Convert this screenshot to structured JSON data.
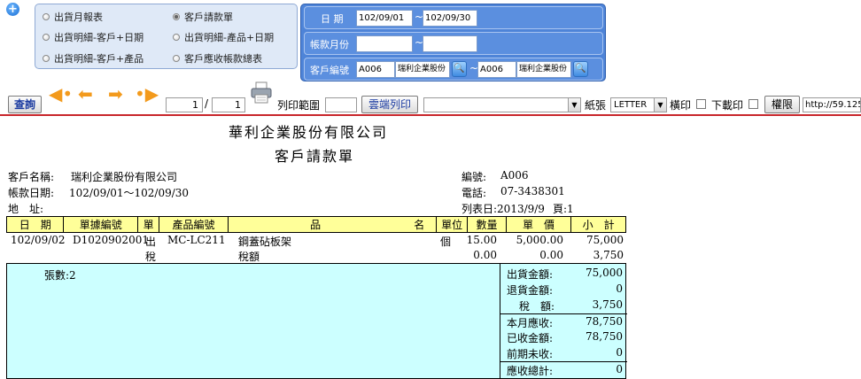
{
  "report_types": [
    "出貨月報表",
    "客戶請款單",
    "出貨明細-客戶+日期",
    "出貨明細-產品+日期",
    "出貨明細-客戶+產品",
    "客戶應收帳款總表"
  ],
  "filters": {
    "date_label": "日 期",
    "date_from": "102/09/01",
    "date_to": "102/09/30",
    "account_month_label": "帳款月份",
    "customer_label": "客戶編號",
    "cust_from_code": "A006",
    "cust_from_name": "瑞利企業股份",
    "cust_to_code": "A006",
    "cust_to_name": "瑞利企業股份",
    "tilde": "~"
  },
  "toolbar": {
    "query": "查詢",
    "page_current": "1",
    "page_sep": "/",
    "page_total": "1",
    "print_range": "列印範圍",
    "cloud_print": "雲端列印",
    "paper_label": "紙張",
    "paper_value": "LETTER",
    "landscape": "橫印",
    "download": "下載印",
    "permission": "權限",
    "url": "http://59.125"
  },
  "report": {
    "company": "華利企業股份有限公司",
    "doc_title": "客戶請款單",
    "cust_name_label": "客戶名稱:",
    "cust_name": "瑞利企業股份有限公司",
    "period_label": "帳款日期:",
    "period": "102/09/01～102/09/30",
    "addr_label": "地　址:",
    "code_label": "編號:",
    "code": "A006",
    "tel_label": "電話:",
    "tel": "07-3438301",
    "print_date": "列表日:2013/9/9",
    "page": "頁:1",
    "columns": [
      "日　期",
      "單據編號",
      "單",
      "產品編號",
      "品",
      "名",
      "單位",
      "數量",
      "單　價",
      "小　計"
    ],
    "row1": {
      "date": "102/09/02",
      "doc_no": "D1020902001",
      "type": "出",
      "product": "MC-LC211",
      "name": "鋼蓋砧板架",
      "unit": "個",
      "qty": "15.00",
      "price": "5,000.00",
      "amount": "75,000"
    },
    "row2": {
      "type": "稅",
      "name": "稅額",
      "qty": "0.00",
      "price": "0.00",
      "amount": "3,750"
    },
    "sheet_count": "張數:2",
    "summary": [
      {
        "label": "出貨金額:",
        "value": "75,000"
      },
      {
        "label": "退貨金額:",
        "value": "0"
      },
      {
        "label": "稅　額:",
        "value": "3,750"
      },
      {
        "label": "本月應收:",
        "value": "78,750"
      },
      {
        "label": "已收金額:",
        "value": "78,750"
      },
      {
        "label": "前期未收:",
        "value": "0"
      },
      {
        "label": "應收總計:",
        "value": "0"
      }
    ]
  }
}
